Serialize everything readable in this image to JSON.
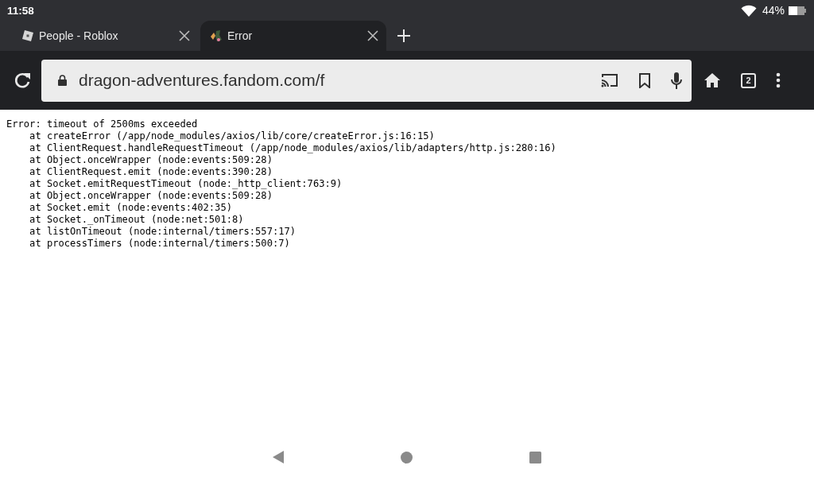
{
  "status_bar": {
    "time": "11:58",
    "battery_percent": "44%"
  },
  "tabs": [
    {
      "title": "People - Roblox",
      "selected": false,
      "kind": "roblox"
    },
    {
      "title": "Error",
      "selected": true,
      "kind": "dragon"
    }
  ],
  "toolbar": {
    "url": "dragon-adventures.fandom.com/f",
    "tab_count": "2"
  },
  "page": {
    "lines": [
      "Error: timeout of 2500ms exceeded",
      "    at createError (/app/node_modules/axios/lib/core/createError.js:16:15)",
      "    at ClientRequest.handleRequestTimeout (/app/node_modules/axios/lib/adapters/http.js:280:16)",
      "    at Object.onceWrapper (node:events:509:28)",
      "    at ClientRequest.emit (node:events:390:28)",
      "    at Socket.emitRequestTimeout (node:_http_client:763:9)",
      "    at Object.onceWrapper (node:events:509:28)",
      "    at Socket.emit (node:events:402:35)",
      "    at Socket._onTimeout (node:net:501:8)",
      "    at listOnTimeout (node:internal/timers:557:17)",
      "    at processTimers (node:internal/timers:500:7)"
    ]
  }
}
